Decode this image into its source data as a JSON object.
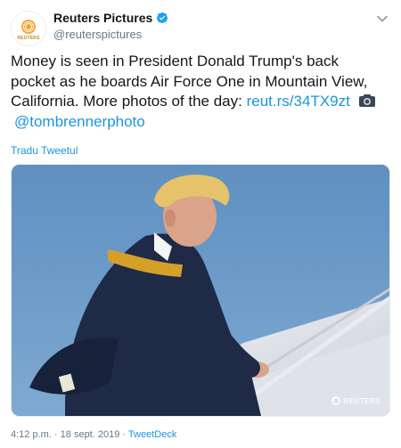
{
  "account": {
    "display_name": "Reuters Pictures",
    "handle": "@reuterspictures",
    "avatar_text": "REUTERS",
    "verified": true
  },
  "tweet": {
    "text_main": "Money is seen in President Donald Trump's back pocket as he boards Air Force One in Mountain View, California. More photos of the day: ",
    "link": "reut.rs/34TX9zt",
    "mention": "@tombrennerphoto",
    "translate_label": "Tradu Tweetul",
    "photo_watermark": "REUTERS"
  },
  "meta": {
    "time": "4:12 p.m.",
    "separator": "·",
    "date": "18 sept. 2019",
    "source": "TweetDeck"
  },
  "icons": {
    "verified": "verified-badge-icon",
    "menu": "chevron-down-icon",
    "camera": "camera-icon"
  },
  "colors": {
    "link": "#1b95e0",
    "muted": "#657786",
    "text": "#14171a"
  }
}
